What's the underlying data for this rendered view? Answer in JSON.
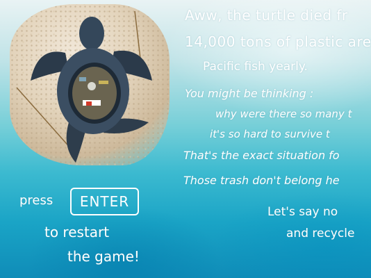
{
  "message": {
    "line1": "Aww, the turtle died fr",
    "line2": "14,000 tons of plastic are",
    "line3": "Pacific fish yearly.",
    "line4": "You might be thinking :",
    "line5": "why were there so many t",
    "line6": "it's so hard to survive t",
    "line7": "That's the exact situation fo",
    "line8": "Those trash don't belong he",
    "line9": "Let's say no",
    "line10": "and recycle"
  },
  "restart": {
    "press_label": "press",
    "key_label": "ENTER",
    "line1": "to restart",
    "line2": "the game!"
  },
  "image": {
    "subject": "sea-turtle-with-plastic-trash-icon"
  },
  "colors": {
    "text": "#ffffff",
    "sea_dark": "#0f8cb8",
    "sea_light": "#bfe3e7",
    "sand": "#e3d4bc"
  }
}
